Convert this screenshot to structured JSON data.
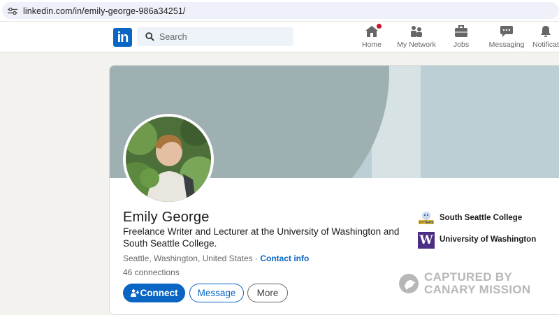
{
  "browser": {
    "url": "linkedin.com/in/emily-george-986a34251/"
  },
  "nav": {
    "logo": "in",
    "search_placeholder": "Search",
    "items": [
      {
        "label": "Home",
        "icon": "home-icon"
      },
      {
        "label": "My Network",
        "icon": "network-icon"
      },
      {
        "label": "Jobs",
        "icon": "briefcase-icon"
      },
      {
        "label": "Messaging",
        "icon": "chat-icon"
      },
      {
        "label": "Notifications",
        "icon": "bell-icon"
      }
    ]
  },
  "profile": {
    "name": "Emily George",
    "headline": "Freelance Writer and Lecturer at the University of Washington and South Seattle College.",
    "location": "Seattle, Washington, United States",
    "separator": " · ",
    "contact_info": "Contact info",
    "connections": "46 connections",
    "buttons": {
      "connect": "Connect",
      "message": "Message",
      "more": "More"
    },
    "education": [
      {
        "name": "South Seattle College",
        "logo_text": "OTTERS"
      },
      {
        "name": "University of Washington",
        "logo_text": "W"
      }
    ]
  },
  "watermark": {
    "line1": "CAPTURED BY",
    "line2": "CANARY MISSION"
  },
  "colors": {
    "brand": "#0a66c2",
    "badge": "#cb112d",
    "uw_purple": "#4b2e83",
    "banner": "#9fb0b3"
  }
}
